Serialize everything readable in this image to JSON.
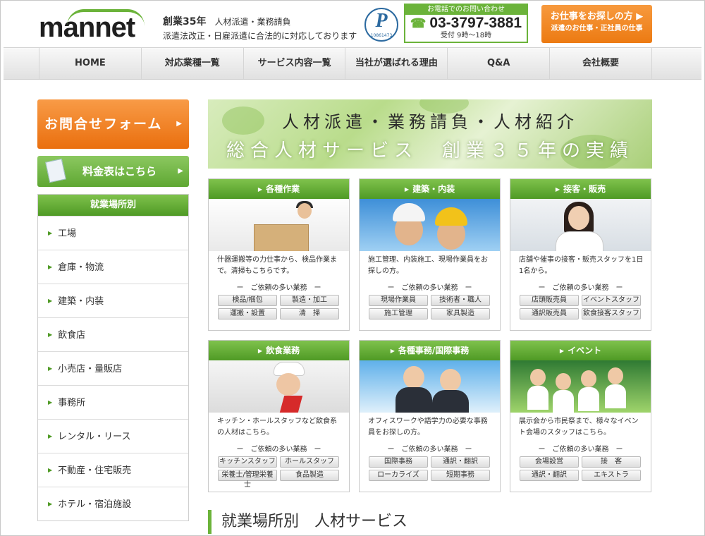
{
  "header": {
    "logo_text": "mannet",
    "tagline_years": "創業35年",
    "tagline_service": "人材派遣・業務請負",
    "tagline_line2": "派遣法改正・日雇派遣に合法的に対応しております",
    "privacy_mark_number": "10861473",
    "phone_heading": "お電話でのお問い合わせ",
    "phone_number": "03-3797-3881",
    "phone_hours": "受付 9時～18時",
    "job_button_line1": "お仕事をお探しの方",
    "job_button_line2": "派遣のお仕事・正社員の仕事"
  },
  "nav": {
    "items": [
      {
        "label": "HOME"
      },
      {
        "label": "対応業種一覧"
      },
      {
        "label": "サービス内容一覧"
      },
      {
        "label": "当社が選ばれる理由"
      },
      {
        "label": "Q&A"
      },
      {
        "label": "会社概要"
      }
    ]
  },
  "sidebar": {
    "contact_label": "お問合せフォーム",
    "price_label": "料金表はこちら",
    "workplace_heading": "就業場所別",
    "workplaces": [
      {
        "label": "工場"
      },
      {
        "label": "倉庫・物流"
      },
      {
        "label": "建築・内装"
      },
      {
        "label": "飲食店"
      },
      {
        "label": "小売店・量販店"
      },
      {
        "label": "事務所"
      },
      {
        "label": "レンタル・リース"
      },
      {
        "label": "不動産・住宅販売"
      },
      {
        "label": "ホテル・宿泊施設"
      }
    ]
  },
  "banner": {
    "line1": "人材派遣・業務請負・人材紹介",
    "line2": "総合人材サービス　創業３５年の実績"
  },
  "cards": [
    {
      "title": "各種作業",
      "desc": "什器運搬等の力仕事から、検品作業まで。清掃もこちらです。",
      "req": "ー　ご依頼の多い業務　ー",
      "tags": [
        "検品/梱包",
        "製造・加工",
        "運搬・設置",
        "清　掃"
      ]
    },
    {
      "title": "建築・内装",
      "desc": "施工管理、内装施工、現場作業員をお探しの方。",
      "req": "ー　ご依頼の多い業務　ー",
      "tags": [
        "現場作業員",
        "技術者・職人",
        "施工管理",
        "家具製造"
      ]
    },
    {
      "title": "接客・販売",
      "desc": "店舗や催事の接客・販売スタッフを1日1名から。",
      "req": "ー　ご依頼の多い業務　ー",
      "tags": [
        "店頭販売員",
        "イベントスタッフ",
        "通訳販売員",
        "飲食接客スタッフ"
      ]
    },
    {
      "title": "飲食業務",
      "desc": "キッチン・ホールスタッフなど飲食系の人材はこちら。",
      "req": "ー　ご依頼の多い業務　ー",
      "tags": [
        "キッチンスタッフ",
        "ホールスタッフ",
        "栄養士/管理栄養士",
        "食品製造"
      ]
    },
    {
      "title": "各種事務/国際事務",
      "desc": "オフィスワークや語学力の必要な事務員をお探しの方。",
      "req": "ー　ご依頼の多い業務　ー",
      "tags": [
        "国際事務",
        "通訳・翻訳",
        "ローカライズ",
        "短期事務"
      ]
    },
    {
      "title": "イベント",
      "desc": "展示会から市民祭まで、様々なイベント会場のスタッフはこちら。",
      "req": "ー　ご依頼の多い業務　ー",
      "tags": [
        "会場設営",
        "接　客",
        "通訳・翻訳",
        "エキストラ"
      ]
    }
  ],
  "section": {
    "title": "就業場所別　人材サービス"
  }
}
